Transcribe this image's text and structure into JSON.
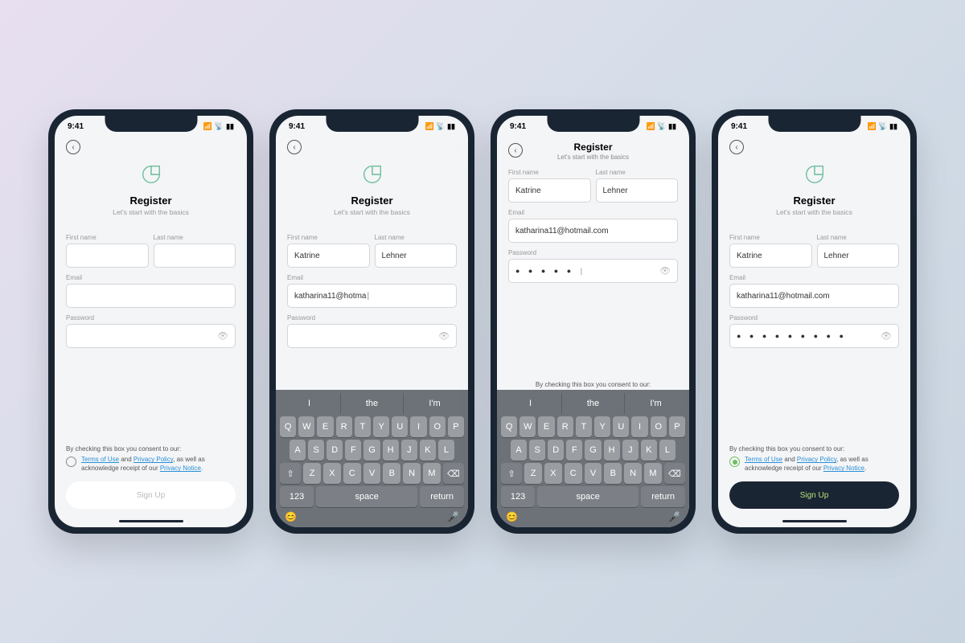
{
  "status": {
    "time": "9:41"
  },
  "hero": {
    "title": "Register",
    "subtitle": "Let's start with the basics"
  },
  "labels": {
    "first": "First name",
    "last": "Last name",
    "email": "Email",
    "password": "Password"
  },
  "consent": {
    "lead": "By checking this box you consent to our:",
    "p1": "Terms of Use",
    "and": " and ",
    "p2": "Privacy Policy",
    "tail1": ", as well as acknowledge receipt of our ",
    "p3": "Privacy Notice",
    "period": "."
  },
  "signup": "Sign Up",
  "keyboard": {
    "suggest": [
      "I",
      "the",
      "I'm"
    ],
    "row1": [
      "Q",
      "W",
      "E",
      "R",
      "T",
      "Y",
      "U",
      "I",
      "O",
      "P"
    ],
    "row2": [
      "A",
      "S",
      "D",
      "F",
      "G",
      "H",
      "J",
      "K",
      "L"
    ],
    "row3": [
      "Z",
      "X",
      "C",
      "V",
      "B",
      "N",
      "M"
    ],
    "shift": "⇧",
    "bksp": "⌫",
    "num": "123",
    "space": "space",
    "return": "return",
    "emoji": "😊",
    "mic": "🎤"
  },
  "screens": {
    "s1": {
      "first": "",
      "last": "",
      "email": "",
      "pwd": "",
      "checked": false
    },
    "s2": {
      "first": "Katrine",
      "last": "Lehner",
      "email": "katharina11@hotma",
      "pwd": ""
    },
    "s3": {
      "first": "Katrine",
      "last": "Lehner",
      "email": "katharina11@hotmail.com",
      "pwd": "● ● ● ● ● "
    },
    "s4": {
      "first": "Katrine",
      "last": "Lehner",
      "email": "katharina11@hotmail.com",
      "pwd": "● ● ● ● ● ● ● ● ●",
      "checked": true
    }
  }
}
